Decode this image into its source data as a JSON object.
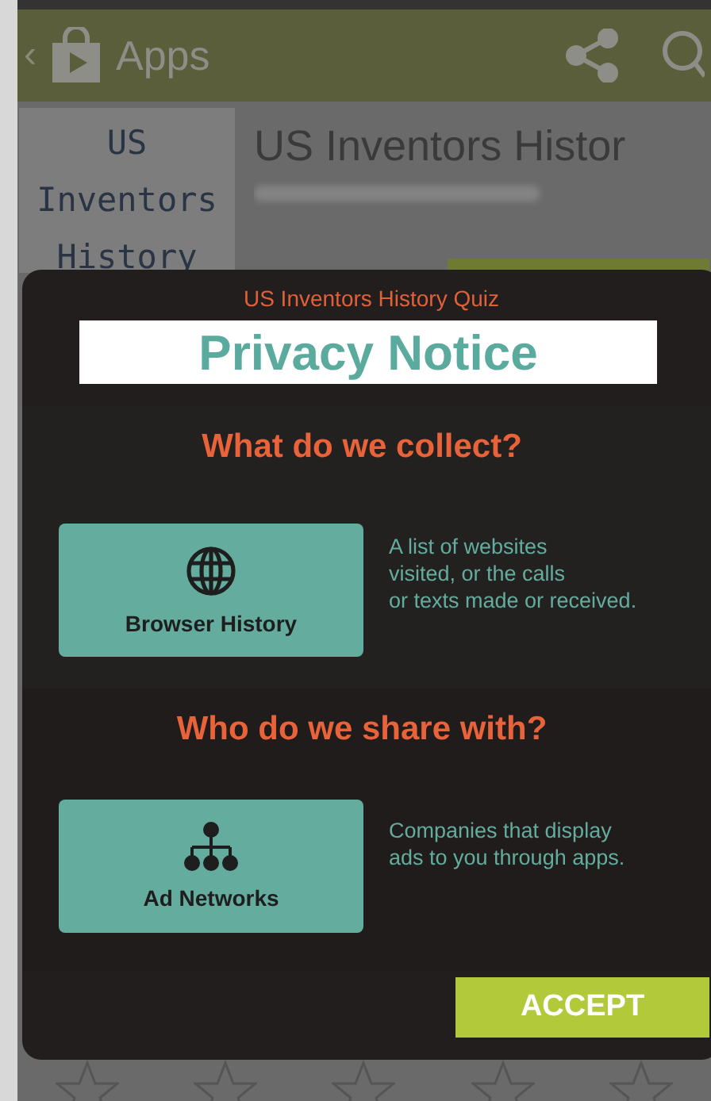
{
  "app_bar": {
    "back": "‹",
    "title": "Apps"
  },
  "app": {
    "tile_title": "US Inventors History",
    "title": "US Inventors Histor"
  },
  "dialog": {
    "app_name": "US Inventors History Quiz",
    "title": "Privacy Notice",
    "sections": [
      {
        "heading": "What do we collect?",
        "item": {
          "kind": "globe",
          "label": "Browser History"
        },
        "description": "A list of websites\nvisited, or the calls\nor texts made or received."
      },
      {
        "heading": "Who do we share with?",
        "item": {
          "kind": "network",
          "label": "Ad Networks"
        },
        "description": "Companies that display\nads to you through apps."
      }
    ],
    "accept": "ACCEPT"
  }
}
